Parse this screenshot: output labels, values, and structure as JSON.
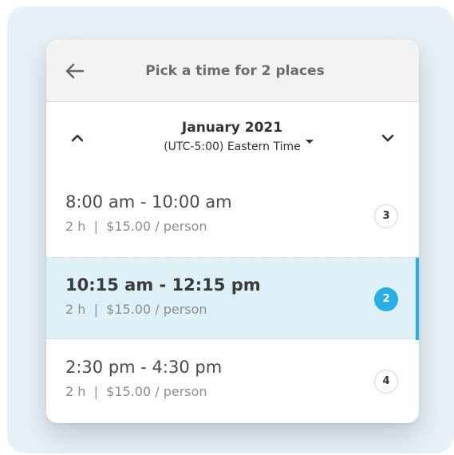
{
  "header": {
    "title": "Pick a time for 2 places",
    "back_icon": "arrow-left-icon"
  },
  "calendar": {
    "month": "January 2021",
    "timezone": "(UTC-5:00) Eastern Time",
    "prev_icon": "chevron-up-icon",
    "next_icon": "chevron-down-icon"
  },
  "slots": [
    {
      "time": "8:00 am - 10:00 am",
      "meta": "2 h  |  $15.00 / person",
      "count": "3",
      "selected": false
    },
    {
      "time": "10:15 am - 12:15 pm",
      "meta": "2 h  |  $15.00 / person",
      "count": "2",
      "selected": true
    },
    {
      "time": "2:30 pm - 4:30 pm",
      "meta": "2 h  |  $15.00 / person",
      "count": "4",
      "selected": false
    }
  ],
  "colors": {
    "accent": "#2aaee6",
    "selected_row": "#dff1f8",
    "header_bg": "#f3f3f3",
    "frame_bg": "#e8f1f5"
  }
}
